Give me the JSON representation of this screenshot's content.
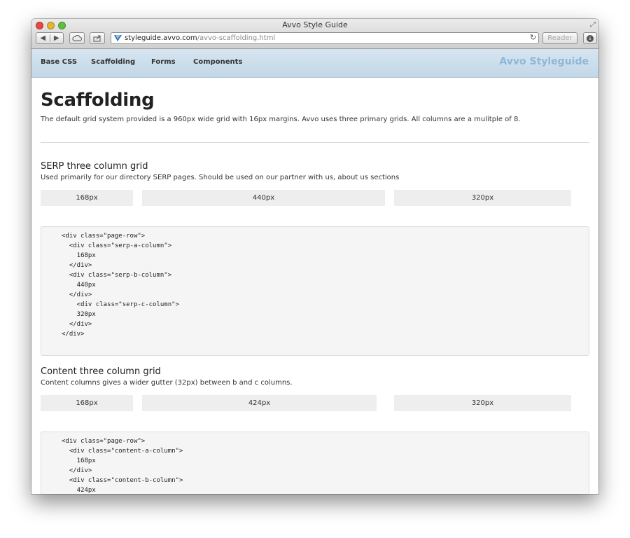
{
  "window": {
    "title": "Avvo Style Guide",
    "url_domain": "styleguide.avvo.com",
    "url_path": "/avvo-scaffolding.html",
    "reader_label": "Reader"
  },
  "nav": {
    "items": [
      {
        "label": "Base CSS"
      },
      {
        "label": "Scaffolding"
      },
      {
        "label": "Forms"
      },
      {
        "label": "Components"
      }
    ],
    "brand": "Avvo Styleguide"
  },
  "page": {
    "title": "Scaffolding",
    "intro": "The default grid system provided is a 960px wide grid with 16px margins. Avvo uses three primary grids. All columns are a mulitple of 8."
  },
  "sections": [
    {
      "title": "SERP three column grid",
      "description": "Used primarily for our directory SERP pages. Should be used on our partner with us, about us sections",
      "columns": [
        "168px",
        "440px",
        "320px"
      ],
      "code": [
        "<div class=\"page-row\">",
        "  <div class=\"serp-a-column\">",
        "    168px",
        "  </div>",
        "  <div class=\"serp-b-column\">",
        "    440px",
        "  </div>",
        "    <div class=\"serp-c-column\">",
        "    320px",
        "  </div>",
        "</div>"
      ]
    },
    {
      "title": "Content three column grid",
      "description": "Content columns gives a wider gutter (32px) between b and c columns.",
      "columns": [
        "168px",
        "424px",
        "320px"
      ],
      "code": [
        "<div class=\"page-row\">",
        "  <div class=\"content-a-column\">",
        "    168px",
        "  </div>",
        "  <div class=\"content-b-column\">",
        "    424px"
      ]
    }
  ]
}
